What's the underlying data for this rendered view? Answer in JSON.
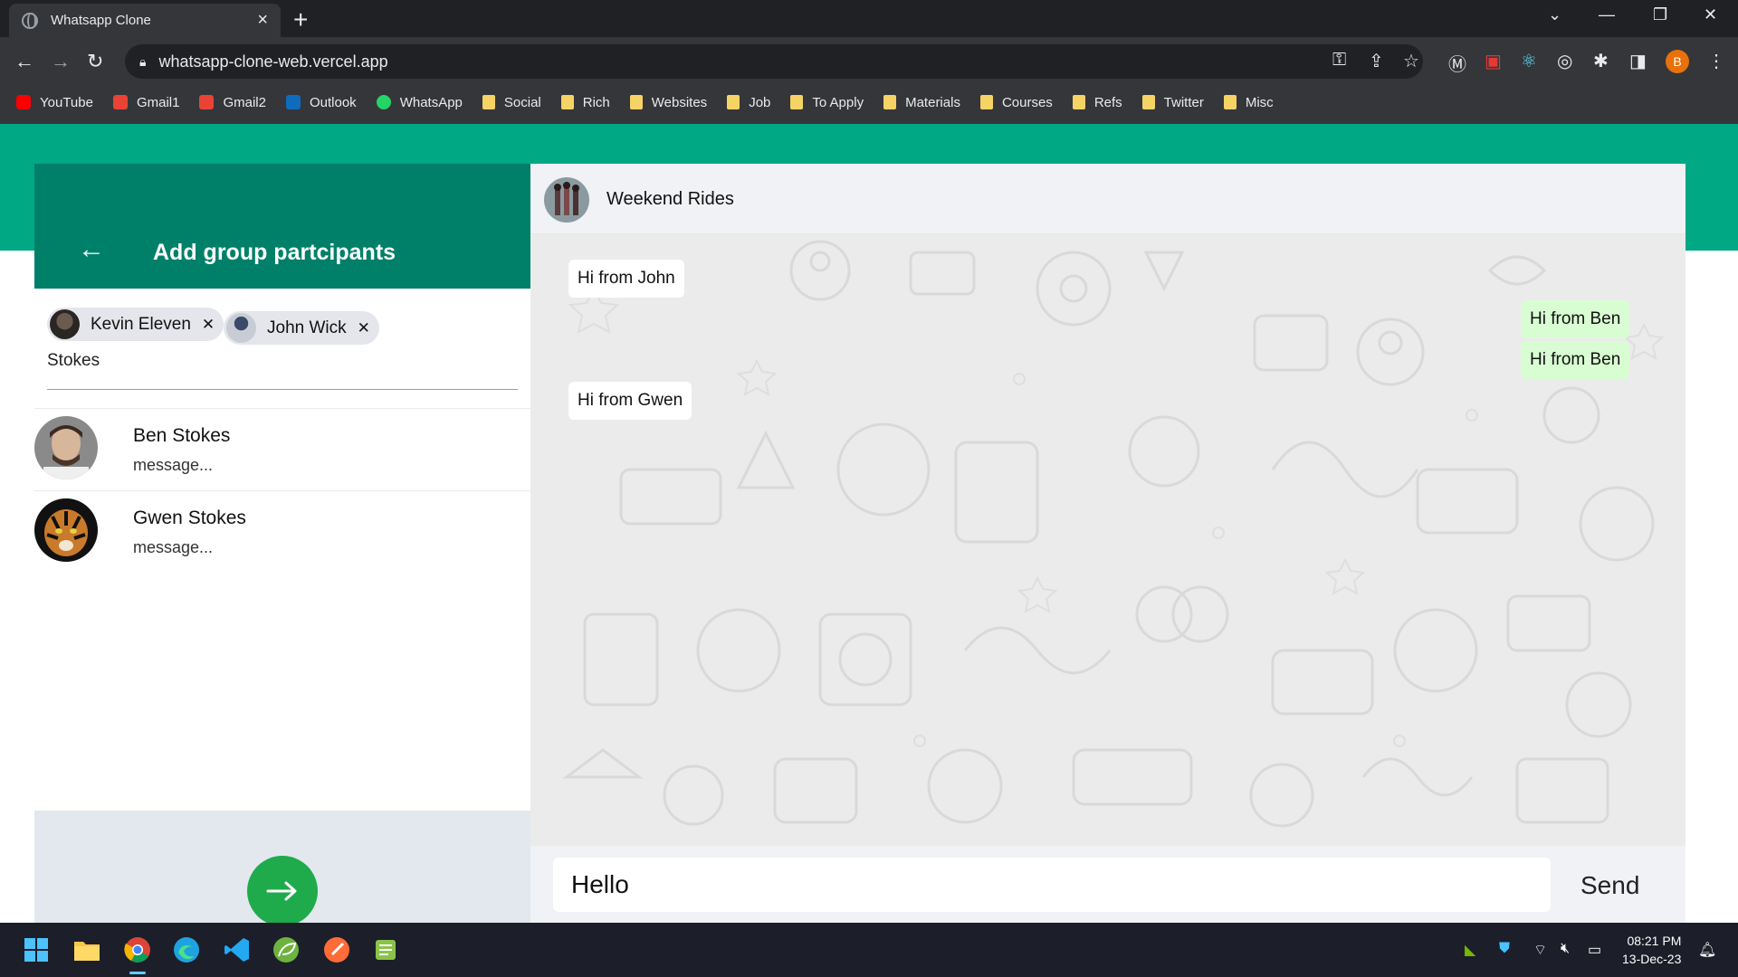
{
  "browser": {
    "tab_title": "Whatsapp Clone",
    "url": "whatsapp-clone-web.vercel.app",
    "profile_initial": "B",
    "bookmarks": [
      {
        "label": "YouTube",
        "icon": "youtube-icon",
        "color": "#ff0000"
      },
      {
        "label": "Gmail1",
        "icon": "gmail-icon",
        "color": "#ea4335"
      },
      {
        "label": "Gmail2",
        "icon": "gmail-icon",
        "color": "#ea4335"
      },
      {
        "label": "Outlook",
        "icon": "outlook-icon",
        "color": "#0f6cbd"
      },
      {
        "label": "WhatsApp",
        "icon": "whatsapp-icon",
        "color": "#25d366"
      },
      {
        "label": "Social",
        "icon": "folder-icon",
        "color": "#f6d365"
      },
      {
        "label": "Rich",
        "icon": "folder-icon",
        "color": "#f6d365"
      },
      {
        "label": "Websites",
        "icon": "folder-icon",
        "color": "#f6d365"
      },
      {
        "label": "Job",
        "icon": "folder-icon",
        "color": "#f6d365"
      },
      {
        "label": "To Apply",
        "icon": "folder-icon",
        "color": "#f6d365"
      },
      {
        "label": "Materials",
        "icon": "folder-icon",
        "color": "#f6d365"
      },
      {
        "label": "Courses",
        "icon": "folder-icon",
        "color": "#f6d365"
      },
      {
        "label": "Refs",
        "icon": "folder-icon",
        "color": "#f6d365"
      },
      {
        "label": "Twitter",
        "icon": "folder-icon",
        "color": "#f6d365"
      },
      {
        "label": "Misc",
        "icon": "folder-icon",
        "color": "#f6d365"
      }
    ]
  },
  "left_panel": {
    "title": "Add group partcipants",
    "chips": [
      {
        "name": "Kevin Eleven"
      },
      {
        "name": "John Wick"
      }
    ],
    "search_value": "Stokes",
    "contacts": [
      {
        "name": "Ben Stokes",
        "message": "message..."
      },
      {
        "name": "Gwen Stokes",
        "message": "message..."
      }
    ]
  },
  "chat": {
    "group_name": "Weekend Rides",
    "messages": [
      {
        "text": "Hi from John",
        "direction": "in"
      },
      {
        "text": "Hi from Ben",
        "direction": "out"
      },
      {
        "text": "Hi from Ben",
        "direction": "out"
      },
      {
        "text": "Hi from Gwen",
        "direction": "in"
      }
    ],
    "input_value": "Hello",
    "send_label": "Send"
  },
  "taskbar": {
    "time": "08:21 PM",
    "date": "13-Dec-23"
  },
  "colors": {
    "accent_green": "#00a884",
    "header_green": "#008069",
    "next_button": "#1fab4b",
    "outgoing_bubble": "#d9fdd3"
  }
}
